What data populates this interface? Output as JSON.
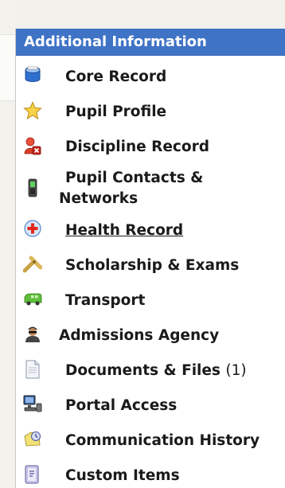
{
  "panel": {
    "title": "Additional Information",
    "items": [
      {
        "label": "Core Record",
        "icon": "core-record-icon"
      },
      {
        "label": "Pupil Profile",
        "icon": "star-icon"
      },
      {
        "label": "Discipline Record",
        "icon": "discipline-icon"
      },
      {
        "label_line1": "Pupil Contacts &",
        "label_line2": "Networks",
        "icon": "mobile-phone-icon"
      },
      {
        "label": "Health Record",
        "icon": "health-plus-icon",
        "underlined": true
      },
      {
        "label": "Scholarship & Exams",
        "icon": "scholarship-icon"
      },
      {
        "label": "Transport",
        "icon": "bus-icon"
      },
      {
        "label": "Admissions Agency",
        "icon": "agent-icon"
      },
      {
        "label": "Documents & Files",
        "count": "(1)",
        "icon": "document-icon"
      },
      {
        "label": "Portal Access",
        "icon": "computer-icon"
      },
      {
        "label": "Communication History",
        "icon": "communication-icon"
      },
      {
        "label": "Custom Items",
        "icon": "custom-items-icon"
      }
    ]
  },
  "colors": {
    "header_bg": "#3f73c6",
    "header_text": "#ffffff",
    "label_text": "#1a1a1a"
  }
}
